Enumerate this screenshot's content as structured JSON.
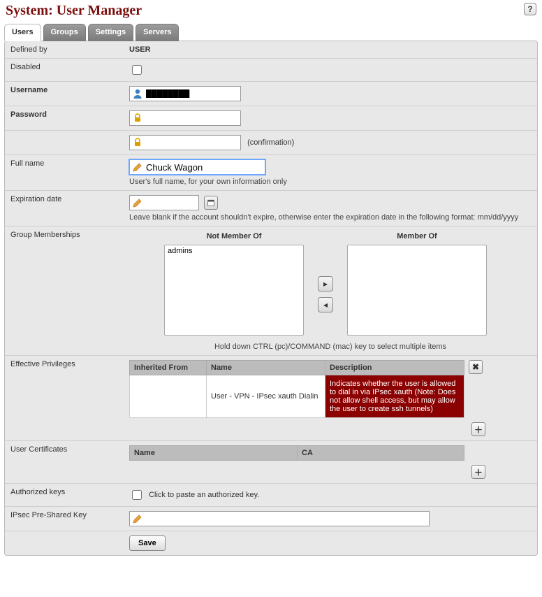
{
  "page": {
    "title": "System: User Manager"
  },
  "tabs": [
    {
      "label": "Users",
      "active": true
    },
    {
      "label": "Groups",
      "active": false
    },
    {
      "label": "Settings",
      "active": false
    },
    {
      "label": "Servers",
      "active": false
    }
  ],
  "form": {
    "defined_by": {
      "label": "Defined by",
      "value": "USER"
    },
    "disabled": {
      "label": "Disabled",
      "checked": false
    },
    "username": {
      "label": "Username",
      "value": "████████"
    },
    "password": {
      "label": "Password",
      "value": ""
    },
    "password_confirm": {
      "hint": "(confirmation)",
      "value": ""
    },
    "fullname": {
      "label": "Full name",
      "value": "Chuck Wagon",
      "hint": "User's full name, for your own information only"
    },
    "expiration": {
      "label": "Expiration date",
      "value": "",
      "hint": "Leave blank if the account shouldn't expire, otherwise enter the expiration date in the following format: mm/dd/yyyy"
    },
    "groups": {
      "label": "Group Memberships",
      "not_member_title": "Not Member Of",
      "member_title": "Member Of",
      "not_member": [
        "admins"
      ],
      "member": [],
      "hint": "Hold down CTRL (pc)/COMMAND (mac) key to select multiple items"
    },
    "privileges": {
      "label": "Effective Privileges",
      "headers": {
        "inherited": "Inherited From",
        "name": "Name",
        "description": "Description"
      },
      "rows": [
        {
          "inherited": "",
          "name": "User - VPN - IPsec xauth Dialin",
          "description": "Indicates whether the user is allowed to dial in via IPsec xauth (Note: Does not allow shell access, but may allow the user to create ssh tunnels)"
        }
      ]
    },
    "certificates": {
      "label": "User Certificates",
      "headers": {
        "name": "Name",
        "ca": "CA"
      },
      "rows": []
    },
    "authorized_keys": {
      "label": "Authorized keys",
      "checkbox_label": "Click to paste an authorized key.",
      "checked": false
    },
    "ipsec_psk": {
      "label": "IPsec Pre-Shared Key",
      "value": ""
    },
    "save_label": "Save"
  }
}
